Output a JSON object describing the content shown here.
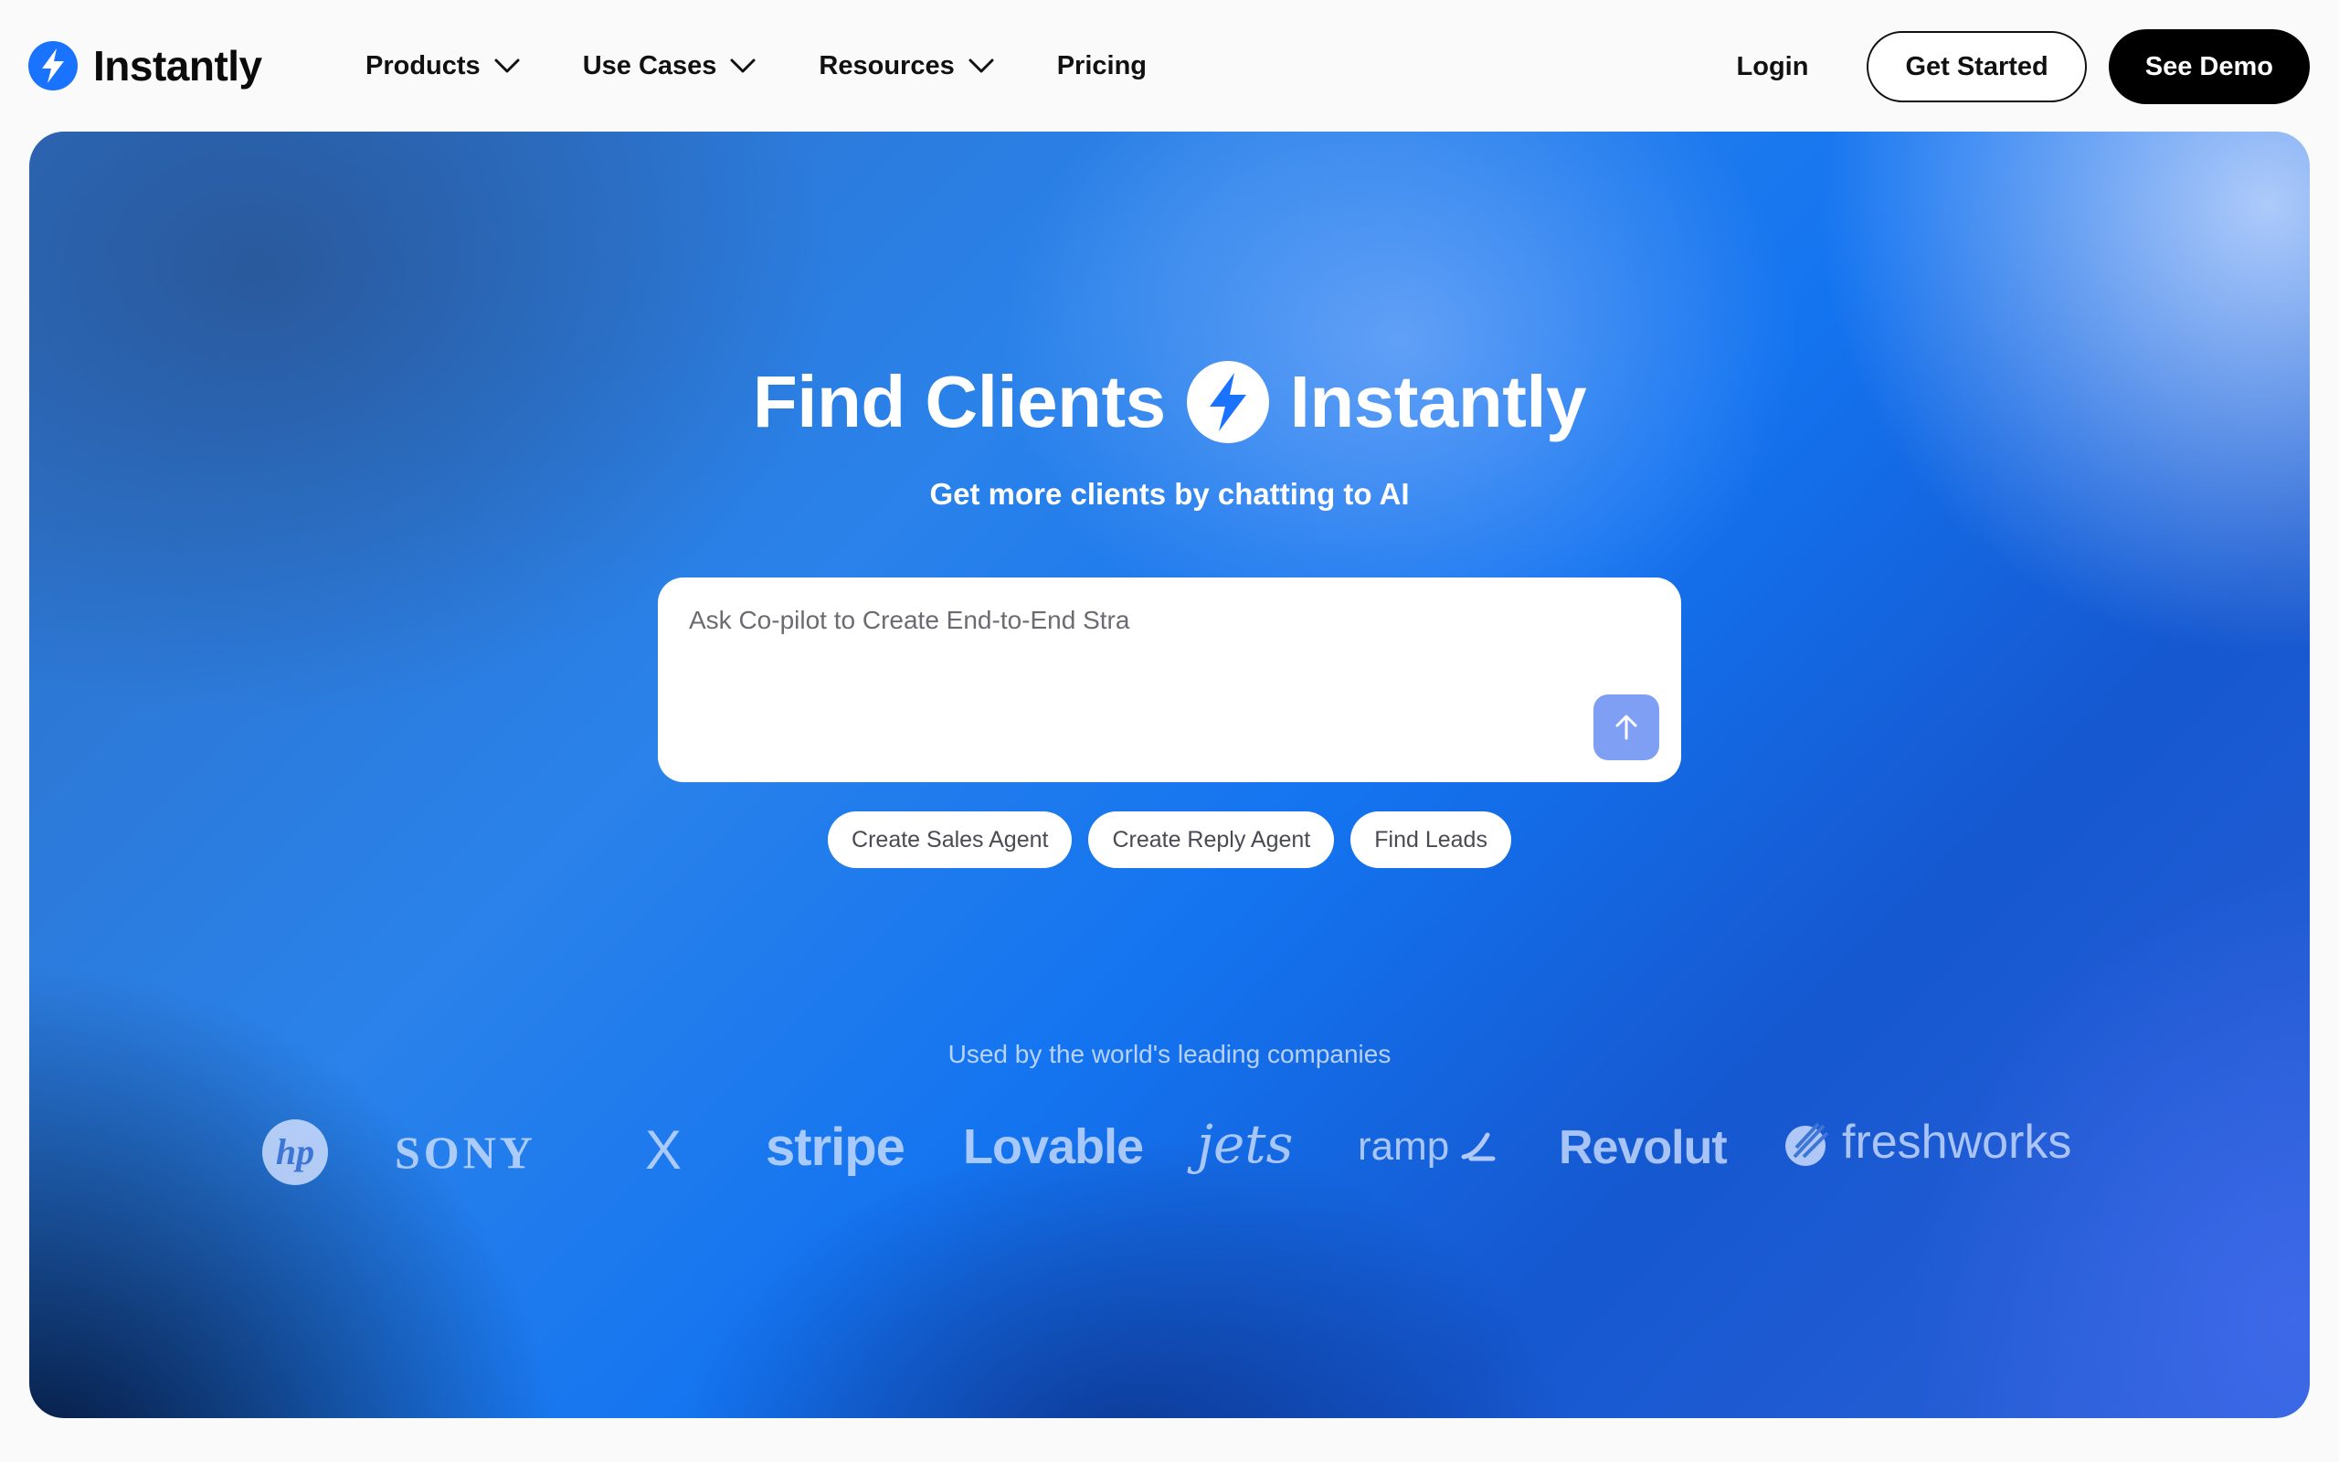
{
  "nav": {
    "brand": "Instantly",
    "menu": [
      {
        "label": "Products",
        "has_dropdown": true
      },
      {
        "label": "Use Cases",
        "has_dropdown": true
      },
      {
        "label": "Resources",
        "has_dropdown": true
      },
      {
        "label": "Pricing",
        "has_dropdown": false
      }
    ],
    "login": "Login",
    "get_started": "Get Started",
    "see_demo": "See Demo"
  },
  "hero": {
    "title_left": "Find Clients",
    "title_right": "Instantly",
    "subtitle": "Get more clients by chatting to AI",
    "prompt": {
      "value": "",
      "placeholder": "Ask Co-pilot to Create End-to-End Stra"
    },
    "chips": [
      "Create Sales Agent",
      "Create Reply Agent",
      "Find Leads"
    ],
    "used_by": "Used by the world's leading companies",
    "companies": {
      "hp": "hp",
      "sony": "SONY",
      "x": "X",
      "stripe": "stripe",
      "lovable": "Lovable",
      "jets": "jets",
      "ramp": "ramp",
      "revolut": "Revolut",
      "freshworks": "freshworks"
    }
  },
  "colors": {
    "brand_blue": "#1a73ff",
    "send_button": "#7f9ff5",
    "dark_button": "#000000",
    "page_bg": "#fafafa"
  },
  "icons": {
    "brand": "bolt-icon",
    "dropdown": "chevron-down-icon",
    "send": "arrow-up-icon"
  }
}
